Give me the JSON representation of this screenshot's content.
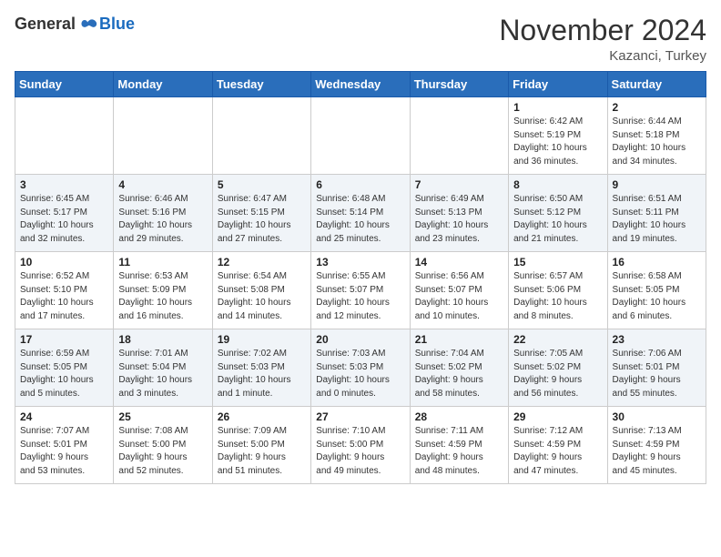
{
  "header": {
    "logo_general": "General",
    "logo_blue": "Blue",
    "month_title": "November 2024",
    "location": "Kazanci, Turkey"
  },
  "days_of_week": [
    "Sunday",
    "Monday",
    "Tuesday",
    "Wednesday",
    "Thursday",
    "Friday",
    "Saturday"
  ],
  "weeks": [
    [
      {
        "day": "",
        "info": ""
      },
      {
        "day": "",
        "info": ""
      },
      {
        "day": "",
        "info": ""
      },
      {
        "day": "",
        "info": ""
      },
      {
        "day": "",
        "info": ""
      },
      {
        "day": "1",
        "info": "Sunrise: 6:42 AM\nSunset: 5:19 PM\nDaylight: 10 hours\nand 36 minutes."
      },
      {
        "day": "2",
        "info": "Sunrise: 6:44 AM\nSunset: 5:18 PM\nDaylight: 10 hours\nand 34 minutes."
      }
    ],
    [
      {
        "day": "3",
        "info": "Sunrise: 6:45 AM\nSunset: 5:17 PM\nDaylight: 10 hours\nand 32 minutes."
      },
      {
        "day": "4",
        "info": "Sunrise: 6:46 AM\nSunset: 5:16 PM\nDaylight: 10 hours\nand 29 minutes."
      },
      {
        "day": "5",
        "info": "Sunrise: 6:47 AM\nSunset: 5:15 PM\nDaylight: 10 hours\nand 27 minutes."
      },
      {
        "day": "6",
        "info": "Sunrise: 6:48 AM\nSunset: 5:14 PM\nDaylight: 10 hours\nand 25 minutes."
      },
      {
        "day": "7",
        "info": "Sunrise: 6:49 AM\nSunset: 5:13 PM\nDaylight: 10 hours\nand 23 minutes."
      },
      {
        "day": "8",
        "info": "Sunrise: 6:50 AM\nSunset: 5:12 PM\nDaylight: 10 hours\nand 21 minutes."
      },
      {
        "day": "9",
        "info": "Sunrise: 6:51 AM\nSunset: 5:11 PM\nDaylight: 10 hours\nand 19 minutes."
      }
    ],
    [
      {
        "day": "10",
        "info": "Sunrise: 6:52 AM\nSunset: 5:10 PM\nDaylight: 10 hours\nand 17 minutes."
      },
      {
        "day": "11",
        "info": "Sunrise: 6:53 AM\nSunset: 5:09 PM\nDaylight: 10 hours\nand 16 minutes."
      },
      {
        "day": "12",
        "info": "Sunrise: 6:54 AM\nSunset: 5:08 PM\nDaylight: 10 hours\nand 14 minutes."
      },
      {
        "day": "13",
        "info": "Sunrise: 6:55 AM\nSunset: 5:07 PM\nDaylight: 10 hours\nand 12 minutes."
      },
      {
        "day": "14",
        "info": "Sunrise: 6:56 AM\nSunset: 5:07 PM\nDaylight: 10 hours\nand 10 minutes."
      },
      {
        "day": "15",
        "info": "Sunrise: 6:57 AM\nSunset: 5:06 PM\nDaylight: 10 hours\nand 8 minutes."
      },
      {
        "day": "16",
        "info": "Sunrise: 6:58 AM\nSunset: 5:05 PM\nDaylight: 10 hours\nand 6 minutes."
      }
    ],
    [
      {
        "day": "17",
        "info": "Sunrise: 6:59 AM\nSunset: 5:05 PM\nDaylight: 10 hours\nand 5 minutes."
      },
      {
        "day": "18",
        "info": "Sunrise: 7:01 AM\nSunset: 5:04 PM\nDaylight: 10 hours\nand 3 minutes."
      },
      {
        "day": "19",
        "info": "Sunrise: 7:02 AM\nSunset: 5:03 PM\nDaylight: 10 hours\nand 1 minute."
      },
      {
        "day": "20",
        "info": "Sunrise: 7:03 AM\nSunset: 5:03 PM\nDaylight: 10 hours\nand 0 minutes."
      },
      {
        "day": "21",
        "info": "Sunrise: 7:04 AM\nSunset: 5:02 PM\nDaylight: 9 hours\nand 58 minutes."
      },
      {
        "day": "22",
        "info": "Sunrise: 7:05 AM\nSunset: 5:02 PM\nDaylight: 9 hours\nand 56 minutes."
      },
      {
        "day": "23",
        "info": "Sunrise: 7:06 AM\nSunset: 5:01 PM\nDaylight: 9 hours\nand 55 minutes."
      }
    ],
    [
      {
        "day": "24",
        "info": "Sunrise: 7:07 AM\nSunset: 5:01 PM\nDaylight: 9 hours\nand 53 minutes."
      },
      {
        "day": "25",
        "info": "Sunrise: 7:08 AM\nSunset: 5:00 PM\nDaylight: 9 hours\nand 52 minutes."
      },
      {
        "day": "26",
        "info": "Sunrise: 7:09 AM\nSunset: 5:00 PM\nDaylight: 9 hours\nand 51 minutes."
      },
      {
        "day": "27",
        "info": "Sunrise: 7:10 AM\nSunset: 5:00 PM\nDaylight: 9 hours\nand 49 minutes."
      },
      {
        "day": "28",
        "info": "Sunrise: 7:11 AM\nSunset: 4:59 PM\nDaylight: 9 hours\nand 48 minutes."
      },
      {
        "day": "29",
        "info": "Sunrise: 7:12 AM\nSunset: 4:59 PM\nDaylight: 9 hours\nand 47 minutes."
      },
      {
        "day": "30",
        "info": "Sunrise: 7:13 AM\nSunset: 4:59 PM\nDaylight: 9 hours\nand 45 minutes."
      }
    ]
  ]
}
